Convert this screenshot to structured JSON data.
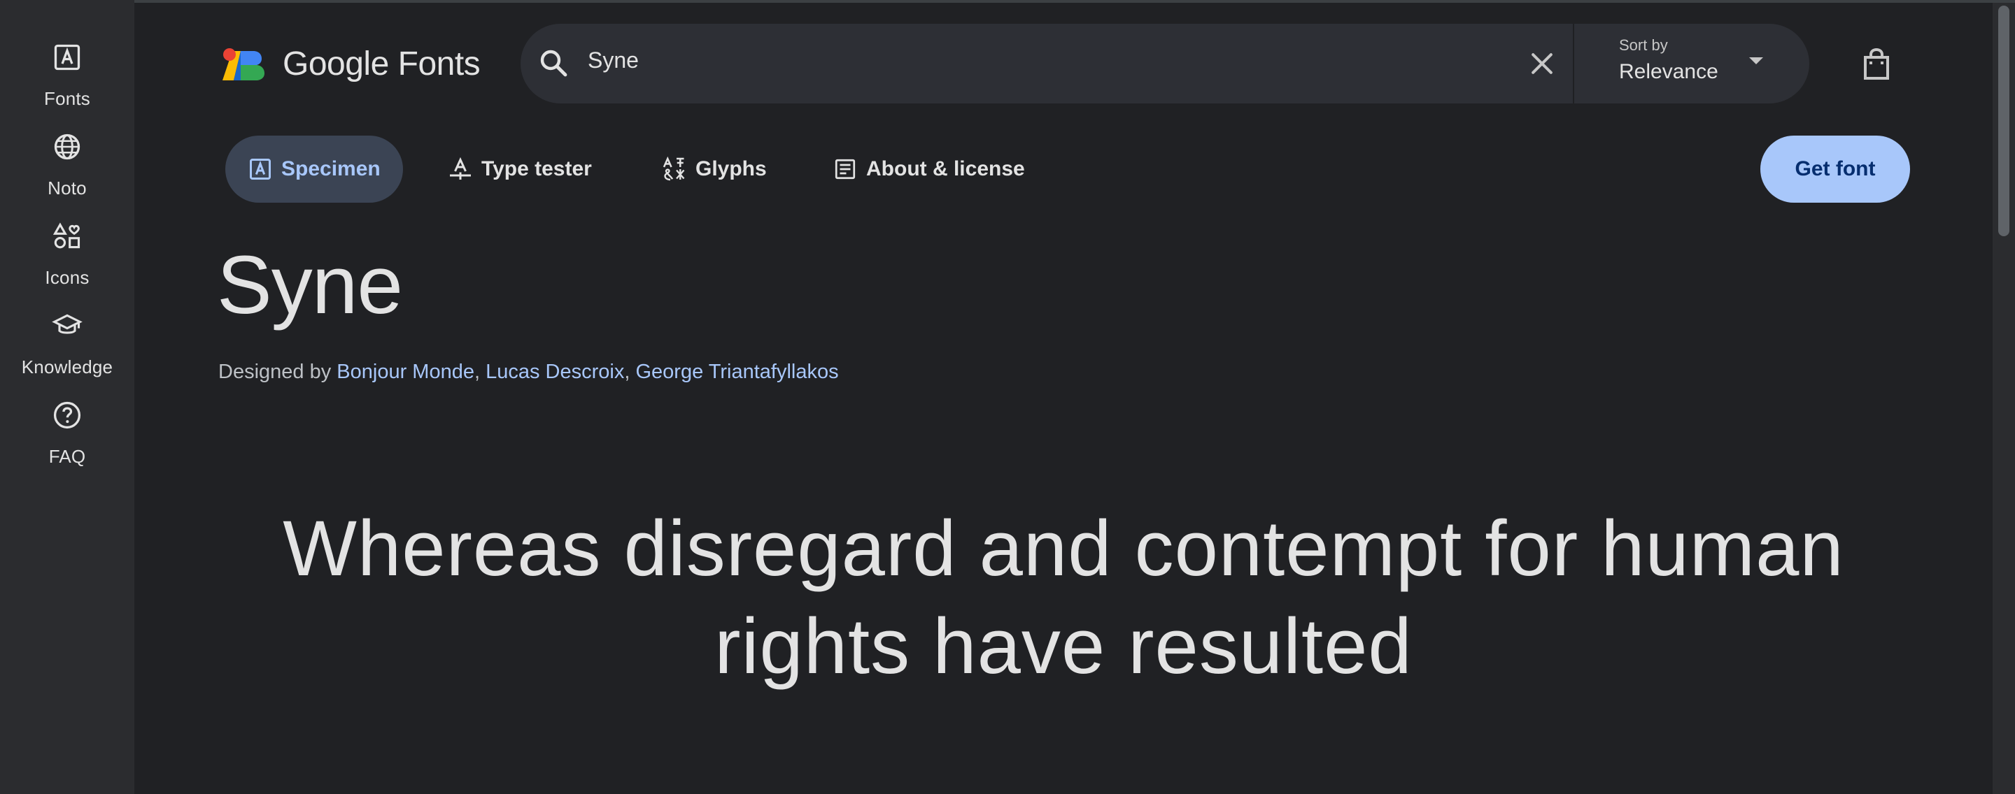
{
  "nav_rail": {
    "items": [
      {
        "label": "Fonts",
        "icon": "font-box-icon"
      },
      {
        "label": "Noto",
        "icon": "globe-icon"
      },
      {
        "label": "Icons",
        "icon": "shapes-icon"
      },
      {
        "label": "Knowledge",
        "icon": "school-icon"
      },
      {
        "label": "FAQ",
        "icon": "help-circle-icon"
      }
    ]
  },
  "header": {
    "logo_text": "Google Fonts",
    "search": {
      "value": "Syne",
      "placeholder": ""
    },
    "sort": {
      "caption": "Sort by",
      "value": "Relevance"
    }
  },
  "tabs": [
    {
      "label": "Specimen",
      "icon": "specimen-icon",
      "active": true
    },
    {
      "label": "Type tester",
      "icon": "type-tester-icon",
      "active": false
    },
    {
      "label": "Glyphs",
      "icon": "glyphs-icon",
      "active": false
    },
    {
      "label": "About & license",
      "icon": "article-icon",
      "active": false
    }
  ],
  "actions": {
    "get_font": "Get font"
  },
  "font": {
    "name": "Syne",
    "designed_by_label": "Designed by",
    "designers": [
      "Bonjour Monde",
      "Lucas Descroix",
      "George Triantafyllakos"
    ],
    "separator": ", "
  },
  "sample_text": "Whereas disregard and contempt for human rights have resulted",
  "colors": {
    "background": "#202124",
    "rail": "#2b2c2f",
    "accent": "#a8c7fa",
    "active_tab_bg": "#3b4454",
    "search_bg": "#2d2f35"
  }
}
